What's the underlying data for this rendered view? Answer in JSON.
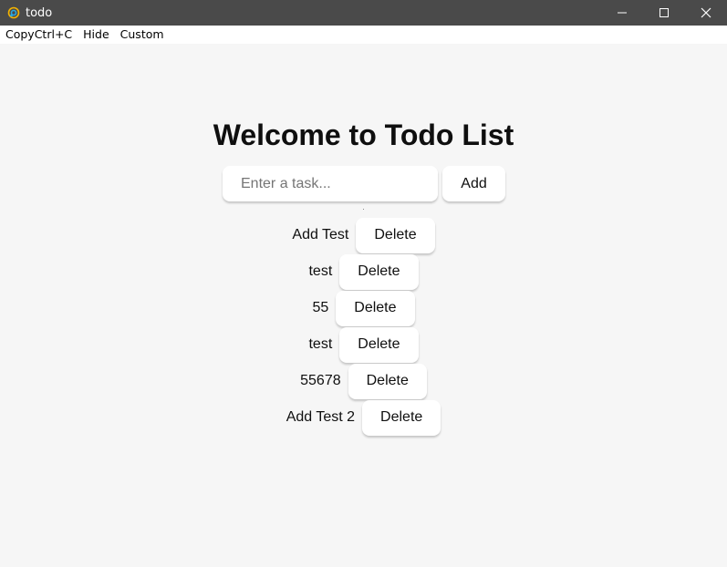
{
  "window": {
    "title": "todo",
    "icon": "app-logo-icon",
    "controls": [
      "minimize-icon",
      "maximize-icon",
      "close-icon"
    ]
  },
  "menubar": {
    "items": [
      "CopyCtrl+C",
      "Hide",
      "Custom"
    ]
  },
  "main": {
    "heading": "Welcome to Todo List",
    "input": {
      "placeholder": "Enter a task...",
      "value": ""
    },
    "add_label": "Add",
    "todos": [
      {
        "text": "Add Test",
        "delete_label": "Delete"
      },
      {
        "text": "test",
        "delete_label": "Delete"
      },
      {
        "text": "55",
        "delete_label": "Delete"
      },
      {
        "text": "test",
        "delete_label": "Delete"
      },
      {
        "text": "55678",
        "delete_label": "Delete"
      },
      {
        "text": "Add Test 2",
        "delete_label": "Delete"
      }
    ]
  },
  "colors": {
    "titlebar_bg": "#4a4a4a",
    "background": "#f6f6f6",
    "button_bg": "#ffffff",
    "text": "#0f0f0f"
  }
}
